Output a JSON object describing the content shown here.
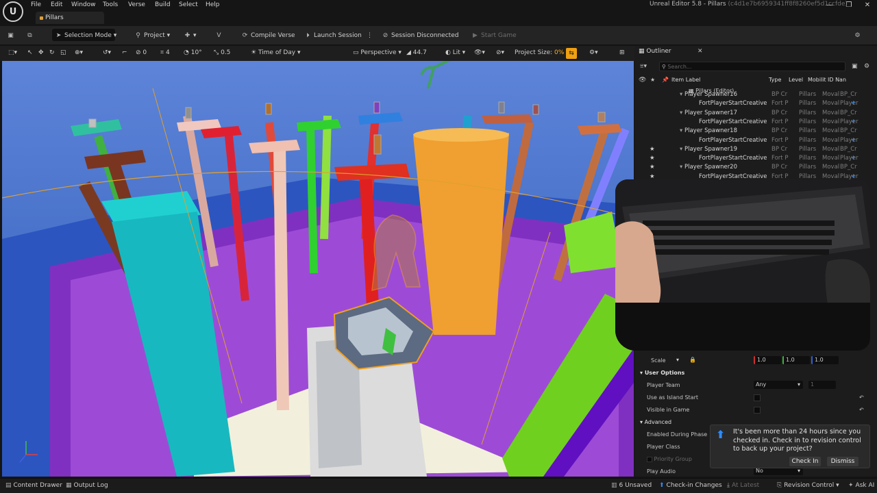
{
  "app": {
    "logo_text": "U",
    "title": "Unreal Editor 5.8 - Pillars",
    "hash": "(c4d1e7b6959341ff8f8260ef5d1ccfde)",
    "minimize": "—",
    "maximize": "❐",
    "close": "✕"
  },
  "menu": [
    "File",
    "Edit",
    "Window",
    "Tools",
    "Verse",
    "Build",
    "Select",
    "Help"
  ],
  "doc_tab": "Pillars",
  "toolbar": {
    "save_icon": "save-icon",
    "selection_mode": "Selection Mode",
    "project": "Project",
    "compile_verse": "Compile Verse",
    "launch_session": "Launch Session",
    "more": "⋮",
    "session_status": "Session Disconnected",
    "start_game": "Start Game"
  },
  "viewport_toolbar": {
    "rotation_snap": "0",
    "grid_snap": "4",
    "angle_snap": "10°",
    "scale_snap": "0.5",
    "time_of_day": "Time of Day",
    "perspective": "Perspective",
    "fov": "44.7",
    "lit": "Lit",
    "project_size_label": "Project Size:",
    "project_size_value": "0%"
  },
  "outliner": {
    "title": "Outliner",
    "close": "✕",
    "search_placeholder": "Search...",
    "columns": {
      "label": "Item Label",
      "type": "Type",
      "level": "Level",
      "mobility": "Mobilit",
      "id": "ID Nan"
    },
    "root": "Pillars (Editor)",
    "rows": [
      {
        "label": "Player Spawner16",
        "type": "BP Cr",
        "level": "Pillars",
        "mob": "Moval",
        "id": "BP_Cr",
        "child": false,
        "star": false
      },
      {
        "label": "FortPlayerStartCreative",
        "type": "Fort P",
        "level": "Pillars",
        "mob": "Moval",
        "id": "Player",
        "child": true,
        "star": false
      },
      {
        "label": "Player Spawner17",
        "type": "BP Cr",
        "level": "Pillars",
        "mob": "Moval",
        "id": "BP_Cr",
        "child": false,
        "star": false
      },
      {
        "label": "FortPlayerStartCreative",
        "type": "Fort P",
        "level": "Pillars",
        "mob": "Moval",
        "id": "Player",
        "child": true,
        "star": false
      },
      {
        "label": "Player Spawner18",
        "type": "BP Cr",
        "level": "Pillars",
        "mob": "Moval",
        "id": "BP_Cr",
        "child": false,
        "star": false
      },
      {
        "label": "FortPlayerStartCreative",
        "type": "Fort P",
        "level": "Pillars",
        "mob": "Moval",
        "id": "Player",
        "child": true,
        "star": false
      },
      {
        "label": "Player Spawner19",
        "type": "BP Cr",
        "level": "Pillars",
        "mob": "Moval",
        "id": "BP_Cr",
        "child": false,
        "star": true
      },
      {
        "label": "FortPlayerStartCreative",
        "type": "Fort P",
        "level": "Pillars",
        "mob": "Moval",
        "id": "Player",
        "child": true,
        "star": true
      },
      {
        "label": "Player Spawner20",
        "type": "BP Cr",
        "level": "Pillars",
        "mob": "Moval",
        "id": "BP_Cr",
        "child": false,
        "star": true
      },
      {
        "label": "FortPlayerStartCreative",
        "type": "Fort P",
        "level": "Pillars",
        "mob": "Moval",
        "id": "Player",
        "child": true,
        "star": true
      }
    ]
  },
  "details": {
    "scale_label": "Scale",
    "scale": [
      "1.0",
      "1.0",
      "1.0"
    ],
    "user_options": "User Options",
    "player_team_label": "Player Team",
    "player_team_value": "Any",
    "player_team_num": "1",
    "use_as_island_start": "Use as Island Start",
    "visible_in_game": "Visible in Game",
    "advanced": "Advanced",
    "enabled_during_phase": "Enabled During Phase",
    "player_class": "Player Class",
    "priority_group": "Priority Group",
    "play_audio": "Play Audio",
    "play_audio_value": "No"
  },
  "toast": {
    "message": "It's been more than 24 hours since you checked in. Check in to revision control to back up your project?",
    "check_in": "Check In",
    "dismiss": "Dismiss"
  },
  "statusbar": {
    "content_drawer": "Content Drawer",
    "output_log": "Output Log",
    "unsaved": "6 Unsaved",
    "checkin_changes": "Check-in Changes",
    "at_latest": "At Latest",
    "revision_control": "Revision Control",
    "ask_ai": "Ask AI"
  }
}
